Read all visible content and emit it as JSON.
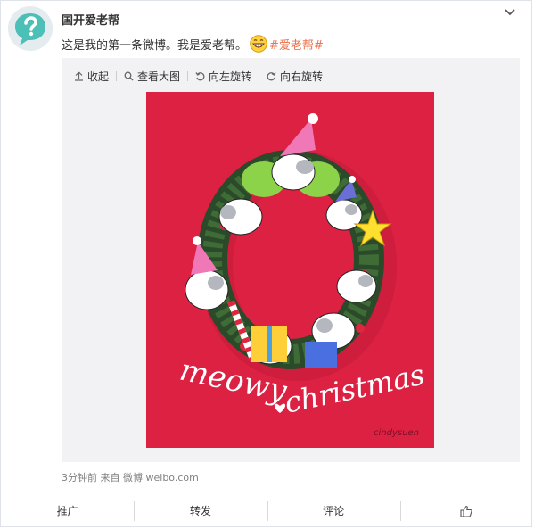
{
  "post": {
    "username": "国开爱老帮",
    "text": "这是我的第一条微博。我是爱老帮。",
    "emoji": "grin-emoji",
    "hashtag": "#爱老帮#"
  },
  "toolbar": {
    "collapse_label": "收起",
    "view_large_label": "查看大图",
    "rotate_left_label": "向左旋转",
    "rotate_right_label": "向右旋转"
  },
  "image": {
    "caption_line1": "meowy",
    "caption_line2": "christmas",
    "signature": "cindysuen",
    "background_color": "#dd2143"
  },
  "meta": {
    "time": "3分钟前",
    "from_label": "来自",
    "source": "微博 weibo.com"
  },
  "footer": {
    "promote_label": "推广",
    "repost_label": "转发",
    "comment_label": "评论"
  },
  "colors": {
    "hashtag": "#eb7350",
    "username": "#333333",
    "meta": "#808080"
  }
}
